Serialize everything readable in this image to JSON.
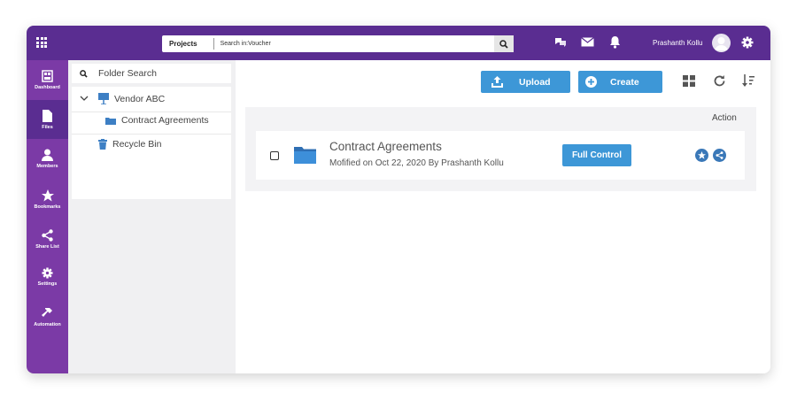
{
  "topbar": {
    "projects_label": "Projects",
    "search_text": "Search in:Voucher",
    "user_name": "Prashanth Kollu"
  },
  "nav": {
    "items": [
      {
        "label": "Dashboard",
        "icon": "dashboard-icon",
        "active": false
      },
      {
        "label": "Files",
        "icon": "file-icon",
        "active": true
      },
      {
        "label": "Members",
        "icon": "person-icon",
        "active": false
      },
      {
        "label": "Bookmarks",
        "icon": "star-icon",
        "active": false
      },
      {
        "label": "Share List",
        "icon": "share-icon",
        "active": false
      },
      {
        "label": "Settings",
        "icon": "gear-icon",
        "active": false
      },
      {
        "label": "Automation",
        "icon": "hammer-icon",
        "active": false
      }
    ]
  },
  "tree": {
    "search_label": "Folder Search",
    "root": "Vendor ABC",
    "child": "Contract Agreements",
    "recycle": "Recycle Bin"
  },
  "toolbar": {
    "upload_label": "Upload",
    "create_label": "Create"
  },
  "list": {
    "action_header": "Action",
    "rows": [
      {
        "title": "Contract Agreements",
        "subtitle": "Mofified on Oct 22, 2020  By Prashanth Kollu",
        "permission": "Full Control"
      }
    ]
  },
  "colors": {
    "topbar": "#5a2d91",
    "sidebar": "#7b3aa6",
    "accent": "#3d97d7"
  }
}
